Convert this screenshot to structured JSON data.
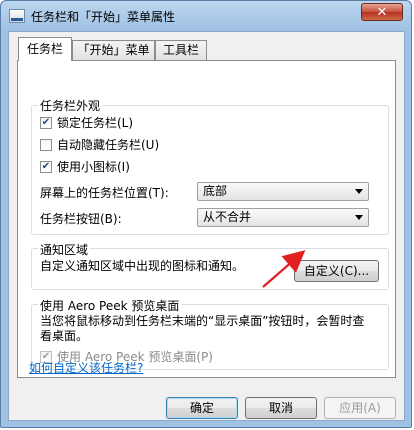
{
  "window": {
    "title": "任务栏和「开始」菜单属性",
    "close_label": "✕"
  },
  "tabs": [
    {
      "label": "任务栏",
      "active": true
    },
    {
      "label": "「开始」菜单",
      "active": false
    },
    {
      "label": "工具栏",
      "active": false
    }
  ],
  "appearance": {
    "title": "任务栏外观",
    "lock_label": "锁定任务栏(L)",
    "lock_checked": true,
    "autohide_label": "自动隐藏任务栏(U)",
    "autohide_checked": false,
    "small_icons_label": "使用小图标(I)",
    "small_icons_checked": true,
    "position_label": "屏幕上的任务栏位置(T):",
    "position_value": "底部",
    "buttons_label": "任务栏按钮(B):",
    "buttons_value": "从不合并"
  },
  "notification": {
    "title": "通知区域",
    "description": "自定义通知区域中出现的图标和通知。",
    "customize_button": "自定义(C)..."
  },
  "aero_peek": {
    "title": "使用 Aero Peek 预览桌面",
    "description": "当您将鼠标移动到任务栏末端的“显示桌面”按钮时，会暂时查看桌面。",
    "checkbox_label": "使用 Aero Peek 预览桌面(P)",
    "checkbox_checked": true,
    "checkbox_disabled": true
  },
  "help_link": "如何自定义该任务栏?",
  "footer": {
    "ok": "确定",
    "cancel": "取消",
    "apply": "应用(A)"
  },
  "colors": {
    "annotation_arrow": "#e02020",
    "link": "#0066cc"
  }
}
